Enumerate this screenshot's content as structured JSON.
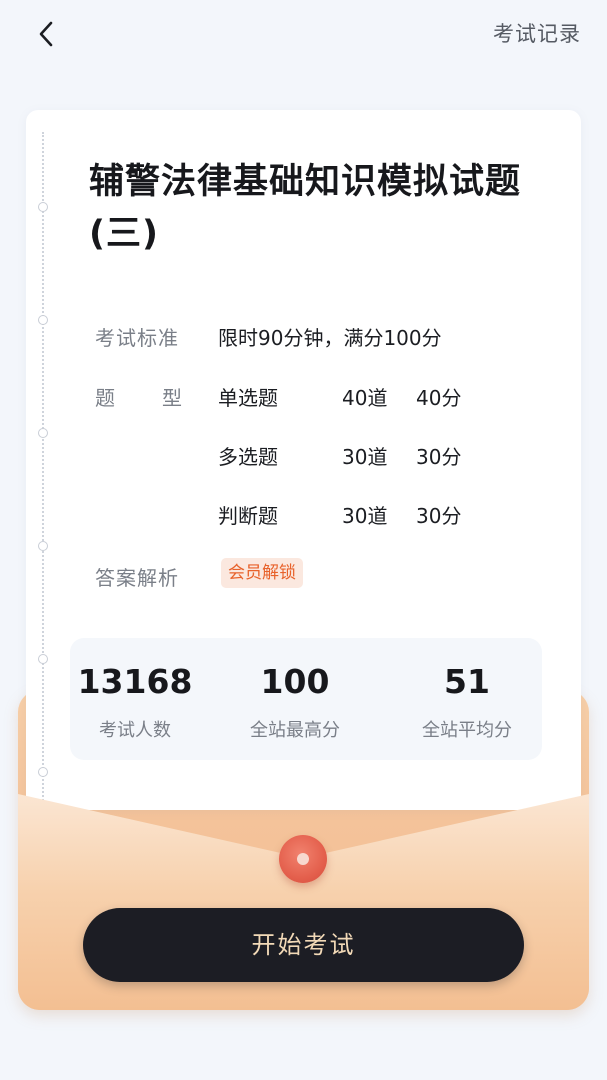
{
  "header": {
    "records_label": "考试记录"
  },
  "exam": {
    "title": "辅警法律基础知识模拟试题(三)",
    "standard_label": "考试标准",
    "standard_value": "限时90分钟，满分100分",
    "type_label_1": "题",
    "type_label_2": "型",
    "question_types": [
      {
        "name": "单选题",
        "count": "40道",
        "score": "40分"
      },
      {
        "name": "多选题",
        "count": "30道",
        "score": "30分"
      },
      {
        "name": "判断题",
        "count": "30道",
        "score": "30分"
      }
    ],
    "analysis_label": "答案解析",
    "analysis_badge": "会员解锁"
  },
  "stats": [
    {
      "value": "13168",
      "label": "考试人数"
    },
    {
      "value": "100",
      "label": "全站最高分"
    },
    {
      "value": "51",
      "label": "全站平均分"
    }
  ],
  "actions": {
    "start_label": "开始考试"
  },
  "colors": {
    "accent_orange": "#e8622b",
    "button_dark": "#1c1d24",
    "button_text": "#f2d9b7",
    "envelope": "#f4c39a",
    "seal": "#e4604d"
  },
  "icons": {
    "back": "chevron-left-icon",
    "seal": "seal-icon"
  }
}
